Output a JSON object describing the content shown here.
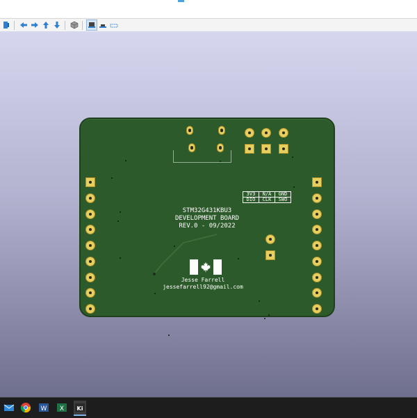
{
  "board": {
    "title_lines": [
      "STM32G431KBU3",
      "DEVELOPMENT BOARD",
      "REV.0 - 09/2022"
    ],
    "author": "Jesse Farrell",
    "email": "jessefarrell92@gmail.com",
    "pin_labels": {
      "row1": [
        "3V3",
        "N/A",
        "GND"
      ],
      "row2": [
        "DIO",
        "CLK",
        "SWO"
      ]
    }
  },
  "toolbar": {
    "icons": [
      "board-icon",
      "arrow-left-icon",
      "arrow-right-icon",
      "arrow-up-icon",
      "arrow-down-icon",
      "3d-box-icon",
      "layers-top-icon",
      "layers-flat-icon",
      "layers-outline-icon"
    ]
  },
  "taskbar": {
    "apps": [
      "mail-icon",
      "chrome-icon",
      "word-icon",
      "excel-icon",
      "kicad-icon"
    ],
    "kicad_label": "Ki",
    "word_label": "W",
    "excel_label": "X"
  },
  "colors": {
    "pcb": "#2d5a2b",
    "pad": "#e7cf5f",
    "background_top": "#d7d6ef",
    "background_bottom": "#6f6f8e",
    "taskbar": "#1d1d1d"
  }
}
